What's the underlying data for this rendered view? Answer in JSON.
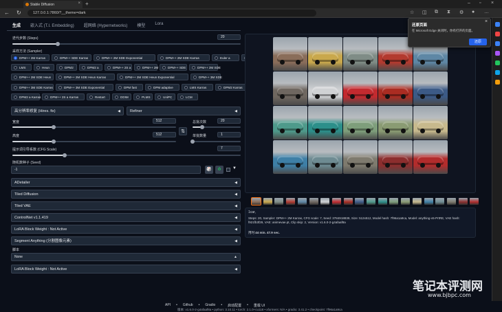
{
  "browser": {
    "tab_title": "Stable Diffusion",
    "url": "127.0.0.1:7860/?__theme=dark"
  },
  "tabs": [
    "生成",
    "嵌入式 (T.I. Embedding)",
    "超网络 (Hypernetworks)",
    "模型",
    "Lora"
  ],
  "steps": {
    "label": "迭代步数 (Steps)",
    "value": "20",
    "fill": 0.2
  },
  "sampler": {
    "label": "采样方法 (Sampler)",
    "selected": "DPM++ 2M Karras",
    "options": [
      [
        "DPM++ 2M Karras",
        "DPM++ SDE Karras",
        "DPM++ 2M SDE Exponential",
        "DPM++ 2M SDE Karras",
        "Euler a",
        "Euler"
      ],
      [
        "LMS",
        "Heun",
        "DPM2",
        "DPM2 a",
        "DPM++ 2S a",
        "DPM++ 2M",
        "DPM++ SDE",
        "DPM++ 2M SDE"
      ],
      [
        "DPM++ 2M SDE Heun",
        "DPM++ 2M SDE Heun Karras",
        "DPM++ 2M SDE Heun Exponential",
        "DPM++ 3M SDE"
      ],
      [
        "DPM++ 3M SDE Karras",
        "DPM++ 3M SDE Exponential",
        "DPM fast",
        "DPM adaptive",
        "LMS Karras",
        "DPM2 Karras"
      ],
      [
        "DPM2 a Karras",
        "DPM++ 2S a Karras",
        "Restart",
        "DDIM",
        "PLMS",
        "UniPC",
        "LCM"
      ]
    ]
  },
  "hires": {
    "label": "高分辨率修复 (Hires. fix)",
    "arrow": "◀"
  },
  "refiner": {
    "label": "Refiner",
    "arrow": "◀"
  },
  "width": {
    "label": "宽度",
    "value": "512",
    "fill": 0.25
  },
  "height": {
    "label": "高度",
    "value": "512",
    "fill": 0.25
  },
  "batch_count": {
    "label": "总批次数",
    "value": "20",
    "fill": 0.2
  },
  "batch_size": {
    "label": "单批数量",
    "value": "1",
    "fill": 0.0
  },
  "swap_icon": "⇅",
  "cfg": {
    "label": "提示词引导系数 (CFG Scale)",
    "value": "7",
    "fill": 0.23
  },
  "seed": {
    "label": "随机数种子 (Seed)",
    "value": "-1"
  },
  "accordions": [
    "ADetailer",
    "Tiled Diffusion",
    "Tiled VAE",
    "ControlNet v1.1.419",
    "LoRA Block Weight : Not Active",
    "Segment Anything (分割图像元素)"
  ],
  "script": {
    "label": "脚本",
    "value": "None"
  },
  "last_accordion": "LoRA Block Weight : Not Active",
  "gallery": {
    "colors": [
      [
        "#8a6d5a",
        "#c9a84c",
        "#7f8c86",
        "#b33a2f",
        "#5e87a5"
      ],
      [
        "#6f6760",
        "#d0d2d4",
        "#c32a2f",
        "#aa2c22",
        "#3c5a86"
      ],
      [
        "#4e9a8b",
        "#2c8f8a",
        "#7e9e7b",
        "#8a9b73",
        "#c7b98d"
      ],
      [
        "#3e7fa6",
        "#6e8b92",
        "#7e7a6e",
        "#8c2e2e",
        "#b22c2c"
      ]
    ],
    "thumb_count": 20
  },
  "toolbar_icons": [
    "📂",
    "💾",
    "🗜",
    "🎨",
    "📐",
    "🎯"
  ],
  "info": {
    "prompt": "1car,",
    "params": "Steps: 20, Sampler: DPM++ 2M Karras, CFG scale: 7, Seed: 3784918839, Size: 512x512, Model hash: 7f96a1a9ca, Model: anything-v5-PrtRE, VAE hash: f921fb3f29, VAE: animevae.pt, Clip skip: 2, Version: v1.6.0-2-g4afaaf8a",
    "time_label": "用时:",
    "time_value": "44 min. 47.9 sec."
  },
  "popup": {
    "title": "还原页面",
    "body": "在 Microsoft Edge 关闭时，你有打开的页面。",
    "button": "还原"
  },
  "footer": {
    "links": [
      "API",
      "Github",
      "Gradio",
      "启动配置",
      "重载 UI"
    ],
    "version": "版本: v1.6.0-2-g4afaaf8a  •  python: 3.10.11  •  torch: 2.1.0+cu118  •  xformers: N/A  •  gradio: 3.41.2  •  checkpoint: 7f96a1a9ca"
  },
  "watermark": {
    "title": "笔记本评测网",
    "url": "www.bjbpc.com"
  }
}
